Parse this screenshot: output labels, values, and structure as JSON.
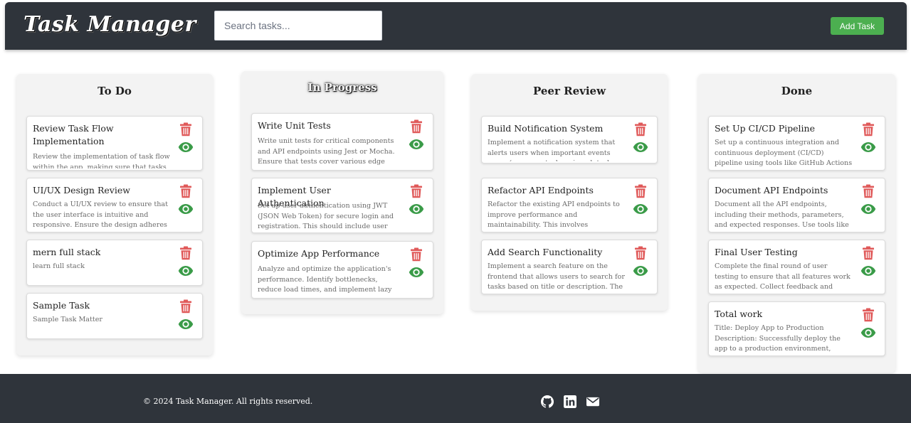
{
  "header": {
    "title": "Task Manager",
    "search_placeholder": "Search tasks...",
    "add_button": "Add Task"
  },
  "columns": [
    {
      "title": "To Do",
      "cards": [
        {
          "title": "Review Task Flow Implementation",
          "desc": "Review the implementation of task flow within the app, making sure that tasks"
        },
        {
          "title": "UI/UX Design Review",
          "desc": "Conduct a UI/UX review to ensure that the user interface is intuitive and responsive. Ensure the design adheres to best practices"
        },
        {
          "title": "mern full stack",
          "desc": "learn full stack"
        },
        {
          "title": "Sample Task",
          "desc": "Sample Task Matter"
        }
      ]
    },
    {
      "title": "In Progress",
      "cards": [
        {
          "title": "Write Unit Tests",
          "desc": "Write unit tests for critical components and API endpoints using Jest or Mocha. Ensure that tests cover various edge cases and"
        },
        {
          "title": "Implement User Authentication",
          "desc": "Set up user authentication using JWT (JSON Web Token) for secure login and registration. This should include user sign-"
        },
        {
          "title": "Optimize App Performance",
          "desc": "Analyze and optimize the application's performance. Identify bottlenecks, reduce load times, and implement lazy loading for"
        }
      ]
    },
    {
      "title": "Peer Review",
      "cards": [
        {
          "title": "Build Notification System",
          "desc": "Implement a notification system that alerts users when important events occur (e.g., new task assigned, task completed). Use"
        },
        {
          "title": "Refactor API Endpoints",
          "desc": "Refactor the existing API endpoints to improve performance and maintainability. This involves optimizing queries"
        },
        {
          "title": "Add Search Functionality",
          "desc": "Implement a search feature on the frontend that allows users to search for tasks based on title or description. The search should be"
        }
      ]
    },
    {
      "title": "Done",
      "cards": [
        {
          "title": "Set Up CI/CD Pipeline",
          "desc": "Set up a continuous integration and continuous deployment (CI/CD) pipeline using tools like GitHub Actions or Jenkins"
        },
        {
          "title": "Document API Endpoints",
          "desc": "Document all the API endpoints, including their methods, parameters, and expected responses. Use tools like Swagger or"
        },
        {
          "title": "Final User Testing",
          "desc": "Complete the final round of user testing to ensure that all features work as expected. Collect feedback and make any necessary"
        },
        {
          "title": "Total work",
          "desc": "Title: Deploy App to Production Description: Successfully deploy the app to a production environment, ensuring all"
        }
      ]
    }
  ],
  "footer": {
    "copyright": "© 2024 Task Manager. All rights reserved.",
    "social_icons": [
      "github-icon",
      "linkedin-icon",
      "mail-icon"
    ]
  },
  "colors": {
    "header_bg": "#2f343b",
    "accent_green": "#4caf50",
    "trash_red": "#e05a5a",
    "eye_green": "#3a9b48"
  }
}
